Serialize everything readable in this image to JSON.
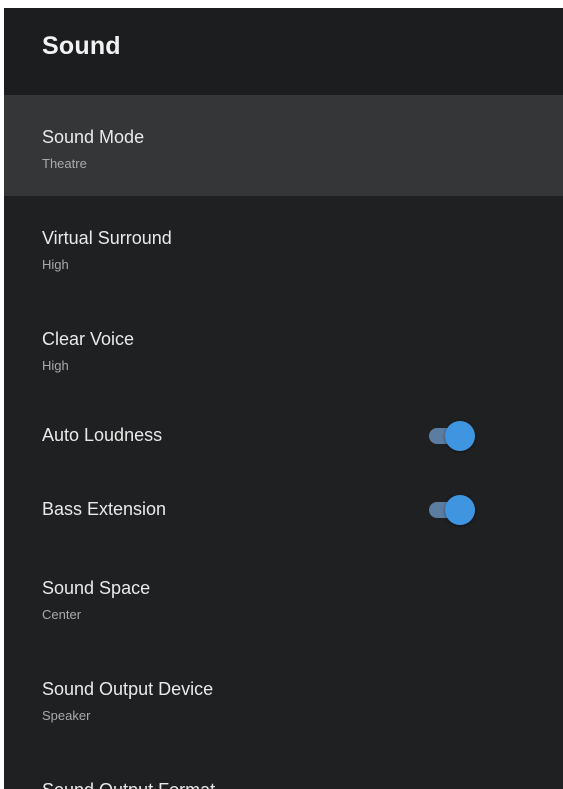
{
  "header": {
    "title": "Sound"
  },
  "items": [
    {
      "label": "Sound Mode",
      "value": "Theatre"
    },
    {
      "label": "Virtual Surround",
      "value": "High"
    },
    {
      "label": "Clear Voice",
      "value": "High"
    },
    {
      "label": "Auto Loudness",
      "toggle": "on"
    },
    {
      "label": "Bass Extension",
      "toggle": "on"
    },
    {
      "label": "Sound Space",
      "value": "Center"
    },
    {
      "label": "Sound Output Device",
      "value": "Speaker"
    },
    {
      "label": "Sound Output Format"
    }
  ],
  "colors": {
    "panel_background": "#1f2022",
    "selected_background": "#353638",
    "toggle_accent": "#3f95e0"
  }
}
